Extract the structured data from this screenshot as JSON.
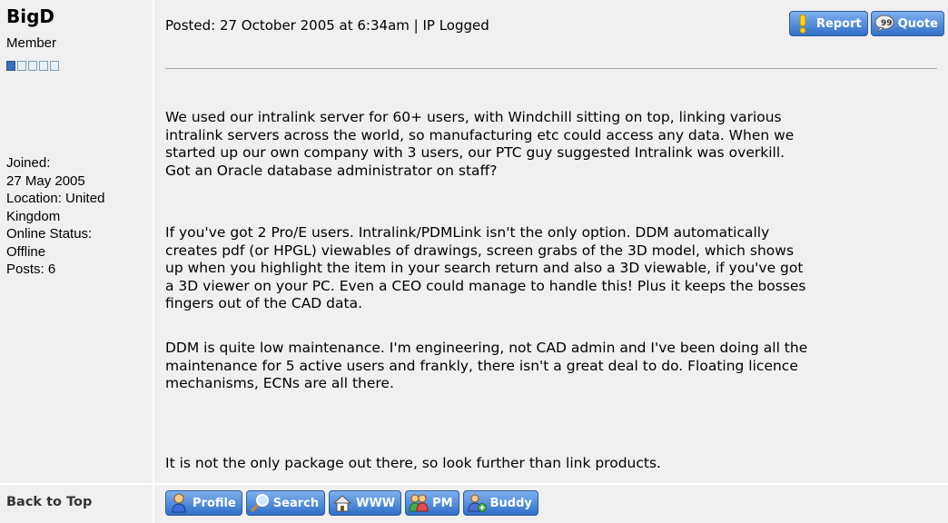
{
  "author": {
    "username": "BigD",
    "rank": "Member",
    "rank_pips_filled": 1,
    "rank_pips_total": 5,
    "joined_label": "Joined:",
    "joined_date": "27 May 2005",
    "location_line1": "Location: United",
    "location_line2": "Kingdom",
    "status_line1": "Online Status:",
    "status_line2": "Offline",
    "posts": "Posts: 6"
  },
  "post": {
    "posted": "Posted: 27 October 2005 at 6:34am | IP Logged",
    "paragraphs": [
      [
        "We used our intralink server for 60+ users, with Windchill sitting on top, linking various",
        "intralink servers across the world, so manufacturing etc could access any data. When we",
        "started up our own company with 3 users, our PTC guy suggested Intralink was overkill.",
        "Got an Oracle database administrator on staff?"
      ],
      [
        "If you've got 2 Pro/E users. Intralink/PDMLink isn't the only option. DDM automatically",
        "creates pdf (or HPGL) viewables of drawings, screen grabs of the 3D model, which shows",
        "up when you highlight the item in your search return and also a 3D viewable, if you've got",
        "a 3D viewer on your PC. Even a CEO could manage to handle this! Plus it keeps the bosses",
        "fingers out of the CAD data."
      ],
      [
        "DDM is quite low maintenance. I'm engineering, not CAD admin and I've been doing all the",
        "maintenance for 5 active users and frankly, there isn't a great deal to do. Floating licence",
        "mechanisms, ECNs are all there."
      ],
      [
        "It is not the only package out there, so look further than link products."
      ]
    ]
  },
  "actions": {
    "report": "Report",
    "quote": "Quote"
  },
  "footer": {
    "back_to_top": "Back to Top",
    "profile": "Profile",
    "search": "Search",
    "www": "WWW",
    "pm": "PM",
    "buddy": "Buddy"
  },
  "icons": {
    "report": "exclamation-icon",
    "quote": "speech-bubble-icon",
    "profile": "user-icon",
    "search": "magnifier-icon",
    "www": "home-icon",
    "pm": "users-icon",
    "buddy": "add-buddy-icon"
  },
  "colors": {
    "panel_bg": "#f0f0f0",
    "button_gradient_top": "#7fb0ee",
    "button_gradient_bottom": "#2f6fc9",
    "divider": "#a9a9a9"
  }
}
